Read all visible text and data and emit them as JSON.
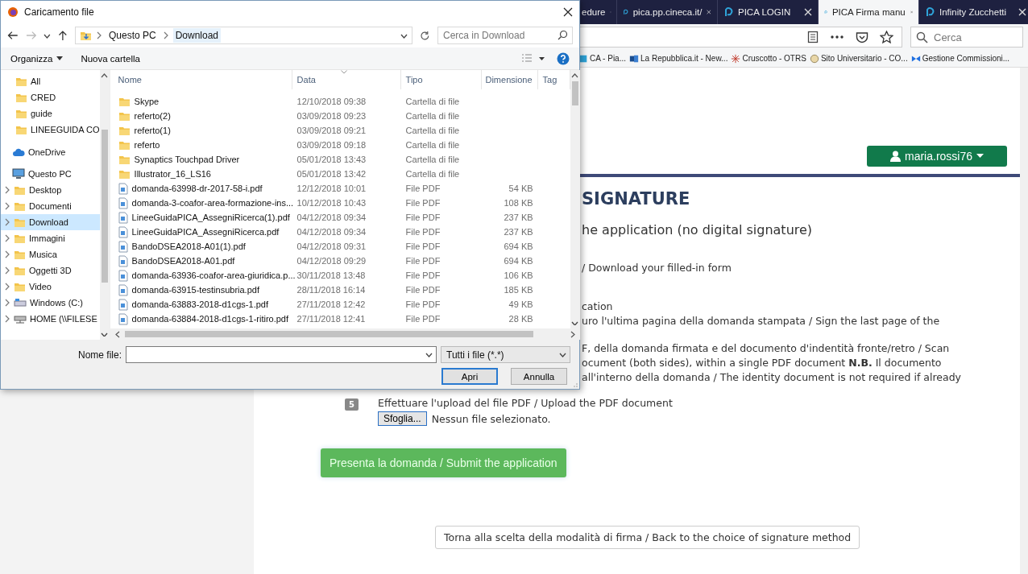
{
  "browser": {
    "tabs": [
      {
        "title": "edure",
        "selected": false
      },
      {
        "title": "pica.pp.cineca.it/",
        "selected": false
      },
      {
        "title": "PICA LOGIN",
        "selected": false
      },
      {
        "title": "PICA Firma manu",
        "selected": true
      },
      {
        "title": "Infinity Zucchetti",
        "selected": false
      }
    ],
    "search": {
      "placeholder": "Cerca"
    },
    "bookmarks": [
      {
        "label": "CA - Pia..."
      },
      {
        "label": "La Repubblica.it - New..."
      },
      {
        "label": "Cruscotto - OTRS"
      },
      {
        "label": "Sito Universitario - CO..."
      },
      {
        "label": "Gestione Commissioni..."
      }
    ]
  },
  "page": {
    "user": "maria.rossi76",
    "heading": "SIGNATURE",
    "subtitle": "he application (no digital signature)",
    "lines": [
      {
        "text": "/ Download your filled-in form"
      },
      {
        "text": "cation"
      },
      {
        "text": "uro l'ultima pagina della domanda stampata / Sign the last page of the"
      },
      {
        "text": "F, della domanda firmata e del documento d'indentità fronte/retro / Scan"
      },
      {
        "text": "ocument (both sides), within a single PDF document **N.B.** Il documento"
      },
      {
        "text": "all'interno della domanda / The identity document is not required if already"
      }
    ],
    "step": {
      "number": "5",
      "text": "Effettuare l'upload del file PDF / Upload the PDF document"
    },
    "file_input": {
      "button": "Sfoglia...",
      "status": "Nessun file selezionato."
    },
    "submit_button": "Presenta la domanda / Submit the application",
    "back_button": "Torna alla scelta della modalità di firma / Back to the choice of signature method"
  },
  "dialog": {
    "title": "Caricamento file",
    "path": [
      {
        "label": "Questo PC",
        "selected": false
      },
      {
        "label": "Download",
        "selected": true
      }
    ],
    "search": {
      "placeholder": "Cerca in Download"
    },
    "toolbar": {
      "organize": "Organizza",
      "new_folder": "Nuova cartella"
    },
    "nav": [
      {
        "label": "All",
        "kind": "folder",
        "selected": false
      },
      {
        "label": "CRED",
        "kind": "folder",
        "selected": false
      },
      {
        "label": "guide",
        "kind": "folder",
        "selected": false
      },
      {
        "label": "LINEEGUIDA CO",
        "kind": "folder",
        "selected": false
      },
      {
        "label": "OneDrive",
        "kind": "cloud",
        "selected": false
      },
      {
        "label": "Questo PC",
        "kind": "computer",
        "selected": false,
        "children": [
          {
            "label": "Desktop",
            "kind": "folder",
            "selected": false
          },
          {
            "label": "Documenti",
            "kind": "folder",
            "selected": false
          },
          {
            "label": "Download",
            "kind": "folder",
            "selected": true
          },
          {
            "label": "Immagini",
            "kind": "folder",
            "selected": false
          },
          {
            "label": "Musica",
            "kind": "folder",
            "selected": false
          },
          {
            "label": "Oggetti 3D",
            "kind": "folder",
            "selected": false
          },
          {
            "label": "Video",
            "kind": "folder",
            "selected": false
          },
          {
            "label": "Windows (C:)",
            "kind": "drive",
            "selected": false
          },
          {
            "label": "HOME (\\\\FILESE",
            "kind": "network",
            "selected": false
          }
        ]
      }
    ],
    "columns": [
      "Nome",
      "Data",
      "Tipo",
      "Dimensione",
      "Tag"
    ],
    "files": [
      {
        "name": "Skype",
        "date": "12/10/2018 09:38",
        "type": "Cartella di file",
        "kind": "folder"
      },
      {
        "name": "referto(2)",
        "date": "03/09/2018 09:23",
        "type": "Cartella di file",
        "kind": "folder"
      },
      {
        "name": "referto(1)",
        "date": "03/09/2018 09:21",
        "type": "Cartella di file",
        "kind": "folder"
      },
      {
        "name": "referto",
        "date": "03/09/2018 09:18",
        "type": "Cartella di file",
        "kind": "folder"
      },
      {
        "name": "Synaptics Touchpad Driver",
        "date": "05/01/2018 13:43",
        "type": "Cartella di file",
        "kind": "folder"
      },
      {
        "name": "Illustrator_16_LS16",
        "date": "05/01/2018 13:42",
        "type": "Cartella di file",
        "kind": "folder"
      },
      {
        "name": "domanda-63998-dr-2017-58-i.pdf",
        "date": "12/12/2018 10:01",
        "type": "File PDF",
        "size": "54 KB",
        "kind": "pdf"
      },
      {
        "name": "domanda-3-coafor-area-formazione-ins...",
        "date": "10/12/2018 10:43",
        "type": "File PDF",
        "size": "108 KB",
        "kind": "pdf"
      },
      {
        "name": "LineeGuidaPICA_AssegniRicerca(1).pdf",
        "date": "04/12/2018 09:34",
        "type": "File PDF",
        "size": "237 KB",
        "kind": "pdf"
      },
      {
        "name": "LineeGuidaPICA_AssegniRicerca.pdf",
        "date": "04/12/2018 09:34",
        "type": "File PDF",
        "size": "237 KB",
        "kind": "pdf"
      },
      {
        "name": "BandoDSEA2018-A01(1).pdf",
        "date": "04/12/2018 09:31",
        "type": "File PDF",
        "size": "694 KB",
        "kind": "pdf"
      },
      {
        "name": "BandoDSEA2018-A01.pdf",
        "date": "04/12/2018 09:29",
        "type": "File PDF",
        "size": "694 KB",
        "kind": "pdf"
      },
      {
        "name": "domanda-63936-coafor-area-giuridica.p...",
        "date": "30/11/2018 13:48",
        "type": "File PDF",
        "size": "106 KB",
        "kind": "pdf"
      },
      {
        "name": "domanda-63915-testinsubria.pdf",
        "date": "28/11/2018 16:14",
        "type": "File PDF",
        "size": "185 KB",
        "kind": "pdf"
      },
      {
        "name": "domanda-63883-2018-d1cgs-1.pdf",
        "date": "27/11/2018 12:42",
        "type": "File PDF",
        "size": "49 KB",
        "kind": "pdf"
      },
      {
        "name": "domanda-63884-2018-d1cgs-1-ritiro.pdf",
        "date": "27/11/2018 12:41",
        "type": "File PDF",
        "size": "28 KB",
        "kind": "pdf"
      }
    ],
    "filename": {
      "label": "Nome file:"
    },
    "filter": "Tutti i file (*.*)",
    "buttons": [
      {
        "label": "Apri",
        "kind": "default"
      },
      {
        "label": "Annulla",
        "kind": "normal"
      }
    ]
  }
}
